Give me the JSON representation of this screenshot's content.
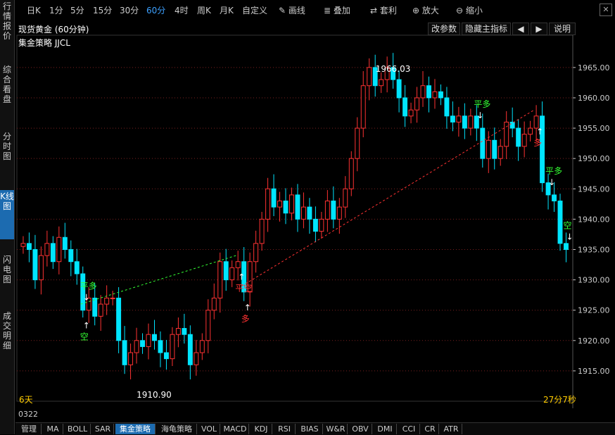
{
  "sidebar": {
    "items": [
      {
        "label": "行情报价",
        "active": false
      },
      {
        "label": "综合看盘",
        "active": false
      },
      {
        "label": "分时图",
        "active": false
      },
      {
        "label": "K线图",
        "active": true
      },
      {
        "label": "闪电图",
        "active": false
      },
      {
        "label": "成交明细",
        "active": false
      }
    ]
  },
  "toolbar": {
    "periods": [
      "日K",
      "1分",
      "5分",
      "15分",
      "30分",
      "60分",
      "4时",
      "周K",
      "月K",
      "自定义"
    ],
    "active_period": "60分",
    "tools": [
      "画线",
      "叠加",
      "套利",
      "放大",
      "缩小"
    ]
  },
  "chart_header": {
    "title": "现货黄金 (60分钟)",
    "buttons": [
      "改参数",
      "隐藏主指标",
      "◀",
      "▶",
      "说明"
    ]
  },
  "strategy_label": "集金策略  JJCL",
  "status": {
    "days": "6天",
    "countdown": "27分7秒",
    "code": "0322"
  },
  "tabs": [
    "管理",
    "MA",
    "BOLL",
    "SAR",
    "集金策略",
    "海龟策略",
    "VOL",
    "MACD",
    "KDJ",
    "RSI",
    "BIAS",
    "W&R",
    "OBV",
    "DMI",
    "CCI",
    "CR",
    "ATR"
  ],
  "active_tab": "集金策略",
  "colors": {
    "up": "#ff3232",
    "down": "#00e5ff",
    "signal_green": "#33ff33",
    "signal_red": "#ff3232",
    "grid": "#7a2020",
    "axis": "#cccccc"
  },
  "chart_data": {
    "type": "candlestick",
    "y_ticks": [
      1915,
      1920,
      1925,
      1930,
      1935,
      1940,
      1945,
      1950,
      1955,
      1960,
      1965
    ],
    "y_tick_labels": [
      "1915.00",
      "1920.00",
      "1925.00",
      "1930.00",
      "1935.00",
      "1940.00",
      "1945.00",
      "1950.00",
      "1955.00",
      "1960.00",
      "1965.00"
    ],
    "ylim": [
      1910,
      1968
    ],
    "annotations": {
      "high": "1966.03",
      "low": "1910.90"
    },
    "closes": [
      1936,
      1935,
      1930,
      1934,
      1936,
      1933,
      1937,
      1935,
      1933,
      1931,
      1925,
      1927,
      1924,
      1926,
      1927,
      1927,
      1920,
      1916,
      1918,
      1920,
      1919,
      1921,
      1920,
      1918,
      1917,
      1921,
      1922,
      1921,
      1916,
      1918,
      1920,
      1925,
      1927,
      1933,
      1930,
      1932,
      1933,
      1928,
      1933,
      1936,
      1940,
      1945,
      1942,
      1943,
      1941,
      1944,
      1940,
      1942,
      1940,
      1938,
      1940,
      1943,
      1940,
      1942,
      1945,
      1950,
      1955,
      1962,
      1965,
      1962,
      1963,
      1965,
      1963,
      1960,
      1957,
      1958,
      1960,
      1962,
      1960,
      1961,
      1960,
      1957,
      1956,
      1957,
      1955,
      1957,
      1955,
      1950,
      1953,
      1950,
      1952,
      1956,
      1955,
      1952,
      1954,
      1955,
      1957,
      1946,
      1944,
      1943,
      1936,
      1935
    ],
    "signals": [
      {
        "text": "平多",
        "color": "green",
        "bar": 10,
        "pos": "above"
      },
      {
        "text": "空",
        "color": "green",
        "bar": 10,
        "pos": "below"
      },
      {
        "text": "平空",
        "color": "red",
        "bar": 36,
        "pos": "below"
      },
      {
        "text": "多",
        "color": "red",
        "bar": 37,
        "pos": "below"
      },
      {
        "text": "平多",
        "color": "green",
        "bar": 76,
        "pos": "above"
      },
      {
        "text": "平多",
        "color": "green",
        "bar": 88,
        "pos": "above"
      },
      {
        "text": "多",
        "color": "red",
        "bar": 86,
        "pos": "below"
      },
      {
        "text": "空",
        "color": "green",
        "bar": 91,
        "pos": "above"
      }
    ]
  }
}
